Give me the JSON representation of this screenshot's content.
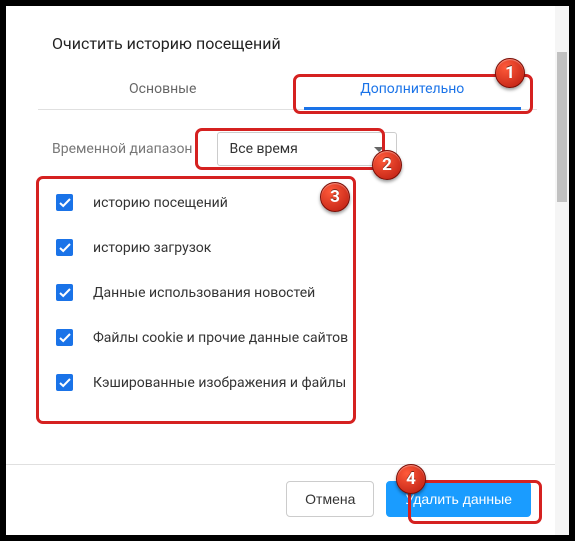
{
  "title": "Очистить историю посещений",
  "tabs": {
    "basic": "Основные",
    "advanced": "Дополнительно"
  },
  "range": {
    "label": "Временной диапазон",
    "value": "Все время"
  },
  "items": [
    {
      "label": "историю посещений"
    },
    {
      "label": "историю загрузок"
    },
    {
      "label": "Данные использования новостей"
    },
    {
      "label": "Файлы cookie и прочие данные сайтов"
    },
    {
      "label": "Кэшированные изображения и файлы"
    }
  ],
  "buttons": {
    "cancel": "Отмена",
    "confirm": "Удалить данные"
  },
  "annotations": {
    "b1": "1",
    "b2": "2",
    "b3": "3",
    "b4": "4"
  }
}
